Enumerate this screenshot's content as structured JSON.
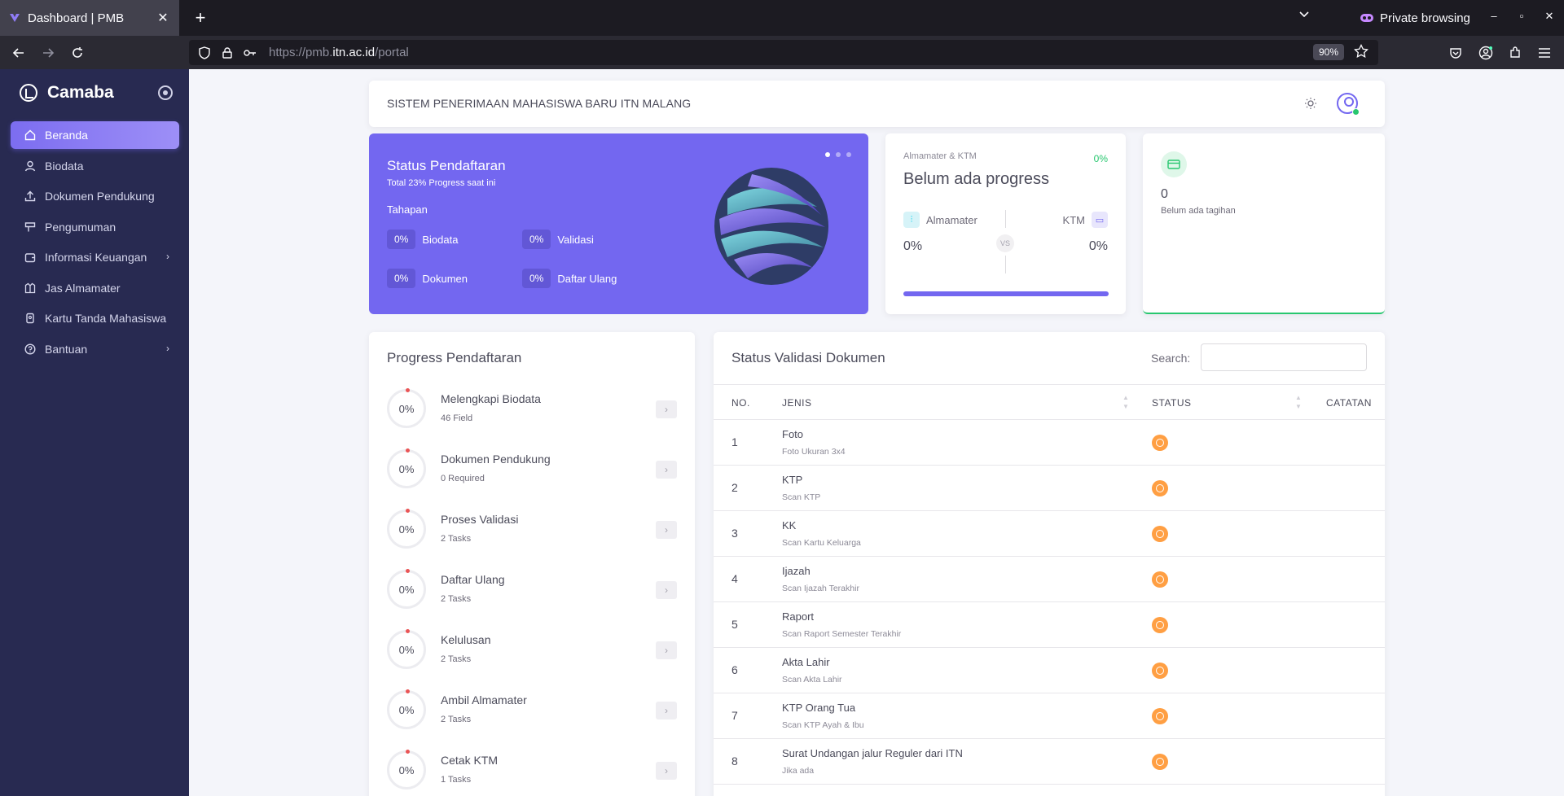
{
  "browser": {
    "tab_title": "Dashboard | PMB",
    "private_label": "Private browsing",
    "url_prefix": "https://pmb.",
    "url_domain": "itn.ac.id",
    "url_path": "/portal",
    "zoom": "90%"
  },
  "sidebar": {
    "brand": "Camaba",
    "items": [
      {
        "label": "Beranda",
        "icon": "home-icon",
        "active": true
      },
      {
        "label": "Biodata",
        "icon": "user-icon"
      },
      {
        "label": "Dokumen Pendukung",
        "icon": "upload-icon"
      },
      {
        "label": "Pengumuman",
        "icon": "megaphone-icon"
      },
      {
        "label": "Informasi Keuangan",
        "icon": "wallet-icon",
        "has_children": true
      },
      {
        "label": "Jas Almamater",
        "icon": "jacket-icon"
      },
      {
        "label": "Kartu Tanda Mahasiswa",
        "icon": "id-card-icon"
      },
      {
        "label": "Bantuan",
        "icon": "help-icon",
        "has_children": true
      }
    ]
  },
  "header": {
    "title": "SISTEM PENERIMAAN MAHASISWA BARU ITN MALANG"
  },
  "status_card": {
    "title": "Status Pendaftaran",
    "subtitle": "Total 23% Progress saat ini",
    "section": "Tahapan",
    "steps": [
      {
        "pct": "0%",
        "label": "Biodata"
      },
      {
        "pct": "0%",
        "label": "Validasi"
      },
      {
        "pct": "0%",
        "label": "Dokumen"
      },
      {
        "pct": "0%",
        "label": "Daftar Ulang"
      }
    ]
  },
  "almamater_card": {
    "caption": "Almamater & KTM",
    "percent": "0%",
    "headline": "Belum ada progress",
    "left_label": "Almamater",
    "right_label": "KTM",
    "left_value": "0%",
    "right_value": "0%",
    "vs": "VS"
  },
  "billing_card": {
    "count": "0",
    "note": "Belum ada tagihan"
  },
  "progress": {
    "title": "Progress Pendaftaran",
    "items": [
      {
        "pct": "0%",
        "title": "Melengkapi Biodata",
        "sub": "46 Field"
      },
      {
        "pct": "0%",
        "title": "Dokumen Pendukung",
        "sub": "0 Required"
      },
      {
        "pct": "0%",
        "title": "Proses Validasi",
        "sub": "2 Tasks"
      },
      {
        "pct": "0%",
        "title": "Daftar Ulang",
        "sub": "2 Tasks"
      },
      {
        "pct": "0%",
        "title": "Kelulusan",
        "sub": "2 Tasks"
      },
      {
        "pct": "0%",
        "title": "Ambil Almamater",
        "sub": "2 Tasks"
      },
      {
        "pct": "0%",
        "title": "Cetak KTM",
        "sub": "1 Tasks"
      }
    ]
  },
  "validation": {
    "title": "Status Validasi Dokumen",
    "search_label": "Search:",
    "columns": [
      "NO.",
      "JENIS",
      "STATUS",
      "CATATAN"
    ],
    "rows": [
      {
        "no": "1",
        "name": "Foto",
        "desc": "Foto Ukuran 3x4"
      },
      {
        "no": "2",
        "name": "KTP",
        "desc": "Scan KTP"
      },
      {
        "no": "3",
        "name": "KK",
        "desc": "Scan Kartu Keluarga"
      },
      {
        "no": "4",
        "name": "Ijazah",
        "desc": "Scan Ijazah Terakhir"
      },
      {
        "no": "5",
        "name": "Raport",
        "desc": "Scan Raport Semester Terakhir"
      },
      {
        "no": "6",
        "name": "Akta Lahir",
        "desc": "Scan Akta Lahir"
      },
      {
        "no": "7",
        "name": "KTP Orang Tua",
        "desc": "Scan KTP Ayah & Ibu"
      },
      {
        "no": "8",
        "name": "Surat Undangan jalur Reguler dari ITN",
        "desc": "Jika ada"
      }
    ],
    "status_color": "#ff9f43"
  },
  "colors": {
    "primary": "#7367f0",
    "sidebar": "#282a51",
    "success": "#28c76f",
    "warning": "#ff9f43"
  }
}
